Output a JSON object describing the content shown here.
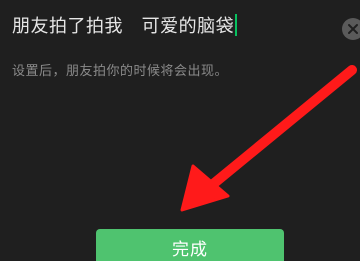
{
  "input": {
    "value": "朋友拍了拍我   可爱的脑袋",
    "caret_color": "#07c160"
  },
  "clear_button": {
    "icon": "close-icon"
  },
  "hint_text": "设置后，朋友拍你的时候将会出现。",
  "annotation": {
    "icon": "arrow-icon",
    "color": "#ff1a1a"
  },
  "done_button": {
    "label": "完成",
    "color": "#4fc36f"
  }
}
